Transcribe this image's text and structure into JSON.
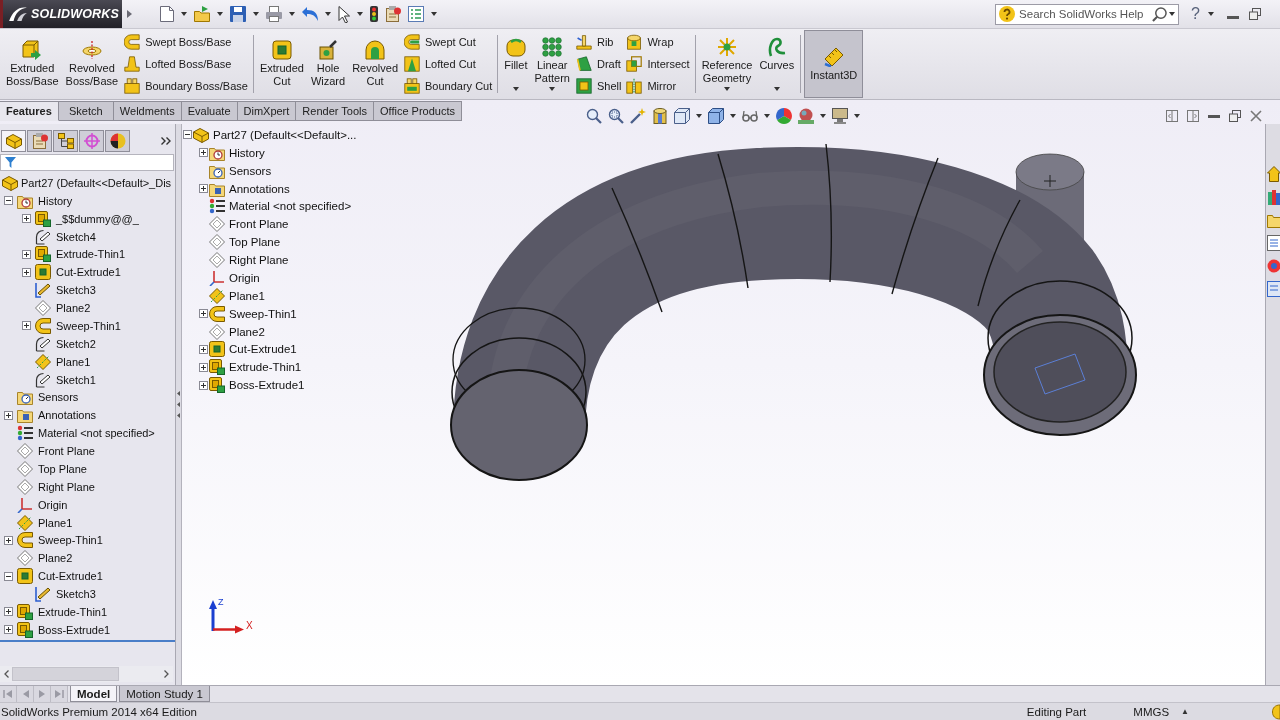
{
  "title_bar": {
    "logo": "SOLIDWORKS",
    "search": {
      "placeholder": "Search SolidWorks Help"
    },
    "help_button": "?"
  },
  "ribbon": {
    "groups": [
      {
        "items": [
          {
            "kind": "large",
            "label": "Extruded Boss/Base",
            "dropdown": false,
            "pressed": false
          },
          {
            "kind": "large",
            "label": "Revolved Boss/Base",
            "dropdown": false,
            "pressed": false
          },
          {
            "kind": "stack",
            "buttons": [
              {
                "label": "Swept Boss/Base"
              },
              {
                "label": "Lofted Boss/Base"
              },
              {
                "label": "Boundary Boss/Base"
              }
            ]
          }
        ]
      },
      {
        "items": [
          {
            "kind": "large",
            "label": "Extruded Cut",
            "dropdown": false,
            "pressed": false
          },
          {
            "kind": "large",
            "label": "Hole Wizard",
            "dropdown": false,
            "pressed": false
          },
          {
            "kind": "large",
            "label": "Revolved Cut",
            "dropdown": false,
            "pressed": false
          },
          {
            "kind": "stack",
            "buttons": [
              {
                "label": "Swept Cut"
              },
              {
                "label": "Lofted Cut"
              },
              {
                "label": "Boundary Cut"
              }
            ]
          }
        ]
      },
      {
        "items": [
          {
            "kind": "large",
            "label": "Fillet",
            "dropdown": true,
            "pressed": false
          },
          {
            "kind": "large",
            "label": "Linear Pattern",
            "dropdown": true,
            "pressed": false
          },
          {
            "kind": "stack",
            "buttons": [
              {
                "label": "Rib"
              },
              {
                "label": "Draft"
              },
              {
                "label": "Shell"
              }
            ]
          },
          {
            "kind": "stack",
            "buttons": [
              {
                "label": "Wrap"
              },
              {
                "label": "Intersect"
              },
              {
                "label": "Mirror"
              }
            ]
          }
        ]
      },
      {
        "items": [
          {
            "kind": "large",
            "label": "Reference Geometry",
            "dropdown": true,
            "pressed": false
          },
          {
            "kind": "large",
            "label": "Curves",
            "dropdown": true,
            "pressed": false
          }
        ]
      },
      {
        "items": [
          {
            "kind": "large",
            "label": "Instant3D",
            "dropdown": false,
            "pressed": true
          }
        ]
      }
    ]
  },
  "command_tabs": [
    {
      "label": "Features",
      "selected": true
    },
    {
      "label": "Sketch",
      "selected": false
    },
    {
      "label": "Weldments",
      "selected": false
    },
    {
      "label": "Evaluate",
      "selected": false
    },
    {
      "label": "DimXpert",
      "selected": false
    },
    {
      "label": "Render Tools",
      "selected": false
    },
    {
      "label": "Office Products",
      "selected": false
    }
  ],
  "feature_manager": {
    "tabs": [
      {
        "kind": "feature-manager",
        "selected": true
      },
      {
        "kind": "property-manager",
        "selected": false
      },
      {
        "kind": "configuration-manager",
        "selected": false
      },
      {
        "kind": "dimxpert-manager",
        "selected": false
      },
      {
        "kind": "display-manager",
        "selected": false
      }
    ],
    "tree": [
      {
        "label": "Part27 (Default<<Default>_Dis",
        "kind": "part",
        "children": [
          {
            "label": "History",
            "kind": "history",
            "expanded": true,
            "children": [
              {
                "label": "_$$dummy@@_",
                "kind": "extrude",
                "expanded": false
              },
              {
                "label": "Sketch4",
                "kind": "sketch"
              },
              {
                "label": "Extrude-Thin1",
                "kind": "extrude",
                "expanded": false
              },
              {
                "label": "Cut-Extrude1",
                "kind": "cut",
                "expanded": false
              },
              {
                "label": "Sketch3",
                "kind": "sketch-3d"
              },
              {
                "label": "Plane2",
                "kind": "plane"
              },
              {
                "label": "Sweep-Thin1",
                "kind": "sweep",
                "expanded": false
              },
              {
                "label": "Sketch2",
                "kind": "sketch"
              },
              {
                "label": "Plane1",
                "kind": "ref-plane"
              },
              {
                "label": "Sketch1",
                "kind": "sketch"
              }
            ]
          },
          {
            "label": "Sensors",
            "kind": "sensors"
          },
          {
            "label": "Annotations",
            "kind": "annotations",
            "expanded": false
          },
          {
            "label": "Material <not specified>",
            "kind": "material"
          },
          {
            "label": "Front Plane",
            "kind": "plane"
          },
          {
            "label": "Top Plane",
            "kind": "plane"
          },
          {
            "label": "Right Plane",
            "kind": "plane"
          },
          {
            "label": "Origin",
            "kind": "origin"
          },
          {
            "label": "Plane1",
            "kind": "ref-plane"
          },
          {
            "label": "Sweep-Thin1",
            "kind": "sweep",
            "expanded": false
          },
          {
            "label": "Plane2",
            "kind": "plane"
          },
          {
            "label": "Cut-Extrude1",
            "kind": "cut",
            "expanded": true,
            "children": [
              {
                "label": "Sketch3",
                "kind": "sketch-3d"
              }
            ]
          },
          {
            "label": "Extrude-Thin1",
            "kind": "extrude",
            "expanded": false
          },
          {
            "label": "Boss-Extrude1",
            "kind": "extrude",
            "expanded": false
          }
        ]
      }
    ]
  },
  "viewport": {
    "flyout_tree": [
      {
        "label": "Part27 (Default<<Default>...",
        "kind": "part",
        "expanded": true,
        "children": [
          {
            "label": "History",
            "kind": "history",
            "expanded": false
          },
          {
            "label": "Sensors",
            "kind": "sensors"
          },
          {
            "label": "Annotations",
            "kind": "annotations",
            "expanded": false
          },
          {
            "label": "Material <not specified>",
            "kind": "material"
          },
          {
            "label": "Front Plane",
            "kind": "plane"
          },
          {
            "label": "Top Plane",
            "kind": "plane"
          },
          {
            "label": "Right Plane",
            "kind": "plane"
          },
          {
            "label": "Origin",
            "kind": "origin"
          },
          {
            "label": "Plane1",
            "kind": "ref-plane"
          },
          {
            "label": "Sweep-Thin1",
            "kind": "sweep",
            "expanded": false
          },
          {
            "label": "Plane2",
            "kind": "plane"
          },
          {
            "label": "Cut-Extrude1",
            "kind": "cut",
            "expanded": false
          },
          {
            "label": "Extrude-Thin1",
            "kind": "extrude",
            "expanded": false
          },
          {
            "label": "Boss-Extrude1",
            "kind": "extrude",
            "expanded": false
          }
        ]
      }
    ],
    "triad": {
      "z_label": "Z",
      "x_label": "X"
    }
  },
  "bottom_tabs": [
    {
      "label": "Model",
      "selected": true
    },
    {
      "label": "Motion Study 1",
      "selected": false
    }
  ],
  "status_bar": {
    "edition": "SolidWorks Premium 2014 x64 Edition",
    "mode": "Editing Part",
    "units": "MMGS",
    "units_menu": "▲"
  }
}
